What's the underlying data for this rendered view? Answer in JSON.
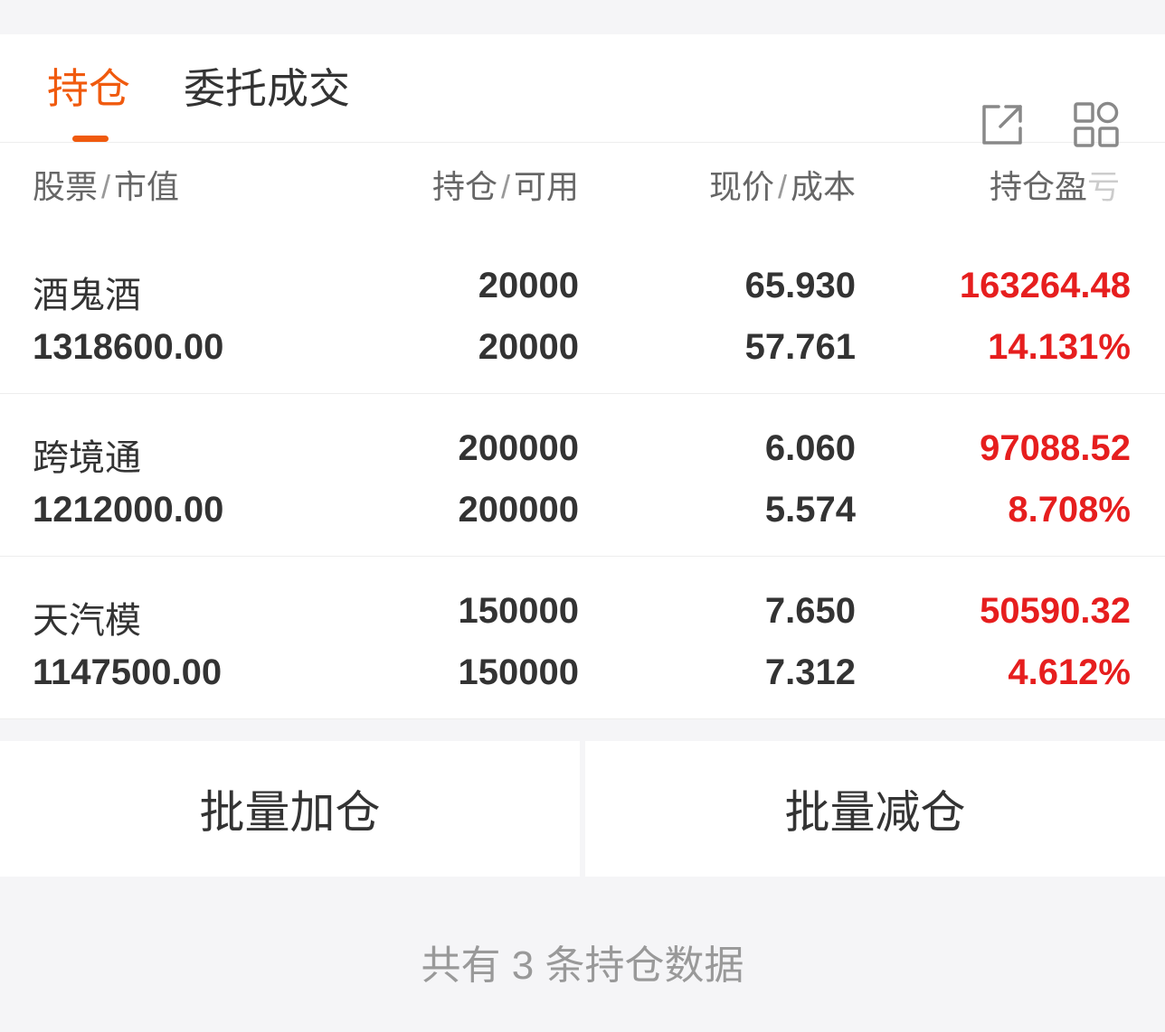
{
  "tabs": [
    {
      "label": "持仓",
      "active": true
    },
    {
      "label": "委托成交",
      "active": false
    }
  ],
  "toolbar": {
    "share_icon": "external-link-icon",
    "grid_icon": "grid-menu-icon"
  },
  "table": {
    "headers": {
      "col1_a": "股票",
      "col1_b": "市值",
      "col2_a": "持仓",
      "col2_b": "可用",
      "col3_a": "现价",
      "col3_b": "成本",
      "col4_a": "持仓盈",
      "col4_b": "亏",
      "sep": "/"
    },
    "rows": [
      {
        "name": "酒鬼酒",
        "market_value": "1318600.00",
        "position": "20000",
        "available": "20000",
        "price": "65.930",
        "cost": "57.761",
        "pnl": "163264.48",
        "pnl_pct": "14.131%"
      },
      {
        "name": "跨境通",
        "market_value": "1212000.00",
        "position": "200000",
        "available": "200000",
        "price": "6.060",
        "cost": "5.574",
        "pnl": "97088.52",
        "pnl_pct": "8.708%"
      },
      {
        "name": "天汽模",
        "market_value": "1147500.00",
        "position": "150000",
        "available": "150000",
        "price": "7.650",
        "cost": "7.312",
        "pnl": "50590.32",
        "pnl_pct": "4.612%"
      }
    ]
  },
  "actions": {
    "add": "批量加仓",
    "reduce": "批量减仓"
  },
  "footer": {
    "text": "共有 3 条持仓数据"
  },
  "colors": {
    "accent": "#f05a0e",
    "profit": "#e61e1e"
  }
}
